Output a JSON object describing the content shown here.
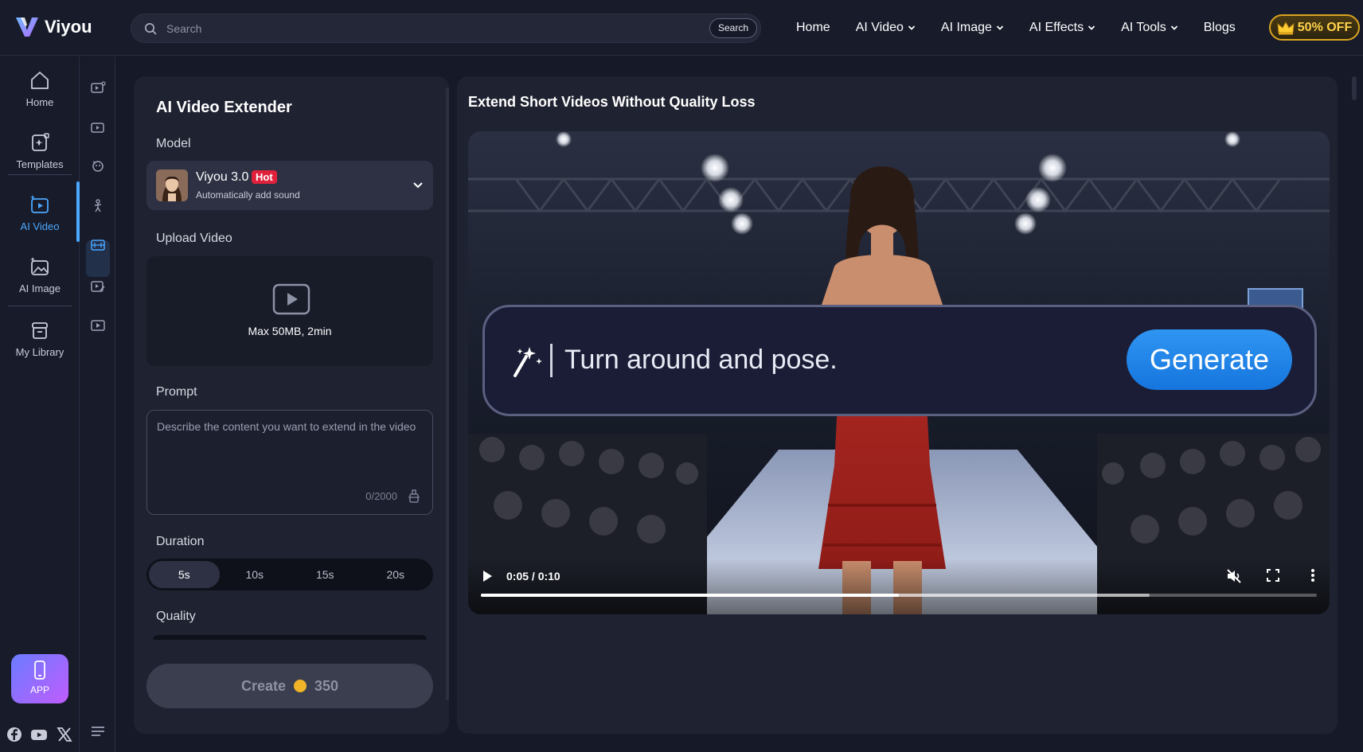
{
  "header": {
    "logo_text": "Viyou",
    "search_placeholder": "Search",
    "search_button": "Search",
    "nav": [
      {
        "label": "Home",
        "dropdown": false
      },
      {
        "label": "AI Video",
        "dropdown": true
      },
      {
        "label": "AI Image",
        "dropdown": true
      },
      {
        "label": "AI Effects",
        "dropdown": true
      },
      {
        "label": "AI Tools",
        "dropdown": true
      },
      {
        "label": "Blogs",
        "dropdown": false
      }
    ],
    "offer_label": "50% OFF"
  },
  "rail": {
    "items": [
      {
        "label": "Home",
        "icon": "home-icon"
      },
      {
        "label": "Templates",
        "icon": "templates-icon"
      },
      {
        "label": "AI Video",
        "icon": "ai-video-icon",
        "active": true
      },
      {
        "label": "AI Image",
        "icon": "ai-image-icon"
      },
      {
        "label": "My Library",
        "icon": "library-icon"
      }
    ],
    "app_label": "APP",
    "socials": [
      "facebook-icon",
      "youtube-icon",
      "x-icon"
    ]
  },
  "panel": {
    "title": "AI Video Extender",
    "model_label": "Model",
    "model": {
      "name": "Viyou 3.0",
      "badge": "Hot",
      "subtitle": "Automatically add sound"
    },
    "upload_label": "Upload Video",
    "upload_hint": "Max 50MB, 2min",
    "prompt_label": "Prompt",
    "prompt_placeholder": "Describe the content you want to extend in the video",
    "prompt_count": "0/2000",
    "duration_label": "Duration",
    "durations": [
      "5s",
      "10s",
      "15s",
      "20s"
    ],
    "duration_selected": "5s",
    "quality_label": "Quality",
    "create_label": "Create",
    "create_cost": "350"
  },
  "preview": {
    "title": "Extend Short Videos Without Quality Loss",
    "overlay_prompt": "Turn around and pose.",
    "overlay_button": "Generate",
    "time": "0:05 / 0:10",
    "progress": 0.5,
    "buffered": 0.8
  },
  "colors": {
    "accent": "#4aa8ff",
    "background": "#161927",
    "panel": "#1f2231",
    "hot_badge": "#e0213c",
    "offer": "#ffd24a"
  }
}
